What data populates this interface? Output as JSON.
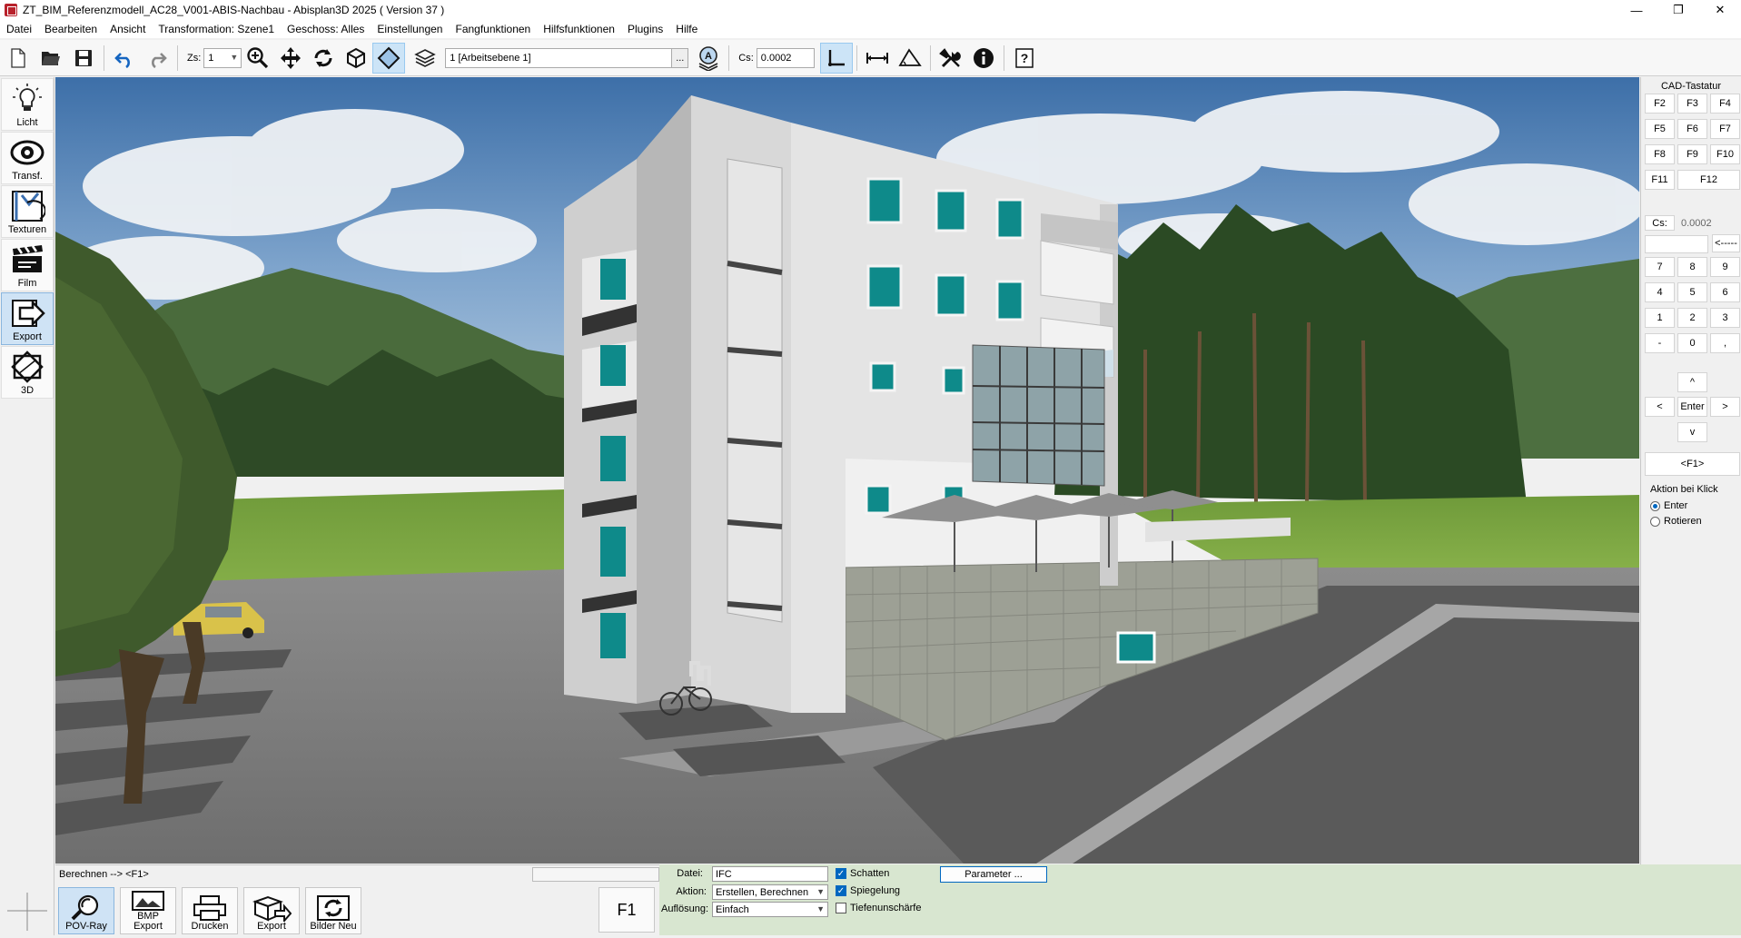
{
  "window": {
    "title": "ZT_BIM_Referenzmodell_AC28_V001-ABIS-Nachbau - Abisplan3D 2025 ( Version 37 )",
    "minimize": "—",
    "maximize": "❐",
    "close": "✕"
  },
  "menu": [
    "Datei",
    "Bearbeiten",
    "Ansicht",
    "Transformation: Szene1",
    "Geschoss: Alles",
    "Einstellungen",
    "Fangfunktionen",
    "Hilfsfunktionen",
    "Plugins",
    "Hilfe"
  ],
  "toolbar": {
    "zs_label": "Zs:",
    "zs_value": "1",
    "layer_value": "1 [Arbeitsebene 1]",
    "layer_more": "...",
    "cs_label": "Cs:",
    "cs_value": "0.0002"
  },
  "left_tools": [
    {
      "label": "Licht",
      "icon": "lightbulb-icon"
    },
    {
      "label": "Transf.",
      "icon": "eye-icon"
    },
    {
      "label": "Texturen",
      "icon": "texture-icon"
    },
    {
      "label": "Film",
      "icon": "clapperboard-icon"
    },
    {
      "label": "Export",
      "icon": "export-arrow-icon"
    },
    {
      "label": "3D",
      "icon": "cube-3d-icon"
    }
  ],
  "cad_keyboard": {
    "title": "CAD-Tastatur",
    "fkeys": [
      "F2",
      "F3",
      "F4",
      "F5",
      "F6",
      "F7",
      "F8",
      "F9",
      "F10",
      "F11",
      "F12"
    ],
    "cs_label": "Cs:",
    "cs_value": "0.0002",
    "backspace": "<-----",
    "numpad": [
      "7",
      "8",
      "9",
      "4",
      "5",
      "6",
      "1",
      "2",
      "3",
      "-",
      "0",
      ","
    ],
    "up": "^",
    "left": "<",
    "enter": "Enter",
    "right": ">",
    "down": "v",
    "f1": "<F1>",
    "action_title": "Aktion bei Klick",
    "action_options": [
      "Enter",
      "Rotieren"
    ],
    "action_selected": "Enter"
  },
  "status": {
    "text": "Berechnen --> <F1>"
  },
  "bottom_tools": [
    {
      "label": "POV-Ray",
      "icon": "povray-icon"
    },
    {
      "label": "BMP Export",
      "icon": "bmp-export-icon"
    },
    {
      "label": "Drucken",
      "icon": "printer-icon"
    },
    {
      "label": "Export",
      "icon": "export-icon"
    },
    {
      "label": "Bilder Neu",
      "icon": "refresh-images-icon"
    }
  ],
  "f1_key": "F1",
  "export_panel": {
    "datei_label": "Datei:",
    "datei_value": "IFC",
    "aktion_label": "Aktion:",
    "aktion_value": "Erstellen, Berechnen",
    "aufloesung_label": "Auflösung:",
    "aufloesung_value": "Einfach",
    "schatten_label": "Schatten",
    "schatten_checked": true,
    "spiegelung_label": "Spiegelung",
    "spiegelung_checked": true,
    "tiefe_label": "Tiefenunschärfe",
    "tiefe_checked": false,
    "parameter_label": "Parameter ..."
  },
  "colors": {
    "accent": "#0067c0",
    "panel_green": "#d8e6d0",
    "window_teal": "#0e8a8a"
  }
}
